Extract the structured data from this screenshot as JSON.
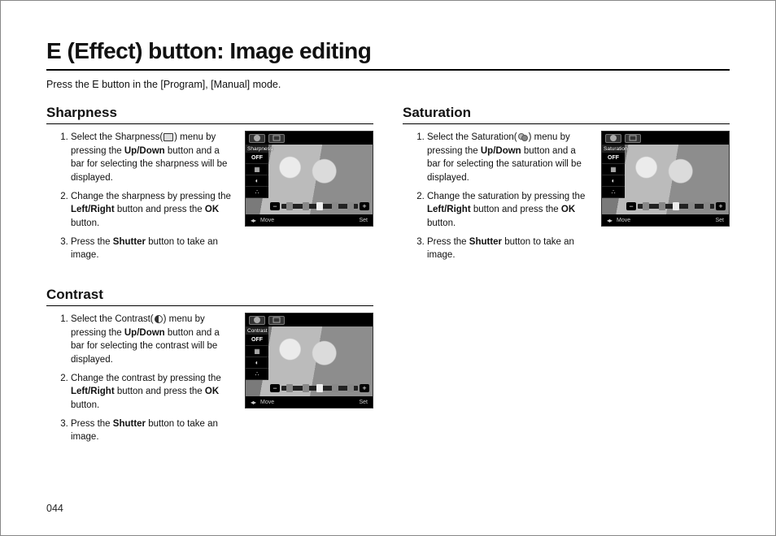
{
  "page_number": "044",
  "title": "E (Effect) button: Image editing",
  "intro": "Press the E button in the [Program], [Manual] mode.",
  "sections": {
    "sharpness": {
      "heading": "Sharpness",
      "step1_a": "Select the Sharpness(",
      "step1_b": ") menu by pressing the ",
      "step1_c": " button and a bar for selecting the sharpness will be displayed.",
      "step2_a": "Change the sharpness by pressing the ",
      "step2_b": " button and press the ",
      "step2_c": " button.",
      "step3_a": "Press the ",
      "step3_b": " button to take an image.",
      "screen_label": "Sharpness"
    },
    "contrast": {
      "heading": "Contrast",
      "step1_a": "Select the Contrast(",
      "step1_b": ") menu by pressing the ",
      "step1_c": " button and a bar for selecting the contrast will be displayed.",
      "step2_a": "Change the contrast by pressing the ",
      "step2_b": " button and press the ",
      "step2_c": " button.",
      "step3_a": "Press the ",
      "step3_b": " button to take an image.",
      "screen_label": "Contrast"
    },
    "saturation": {
      "heading": "Saturation",
      "step1_a": "Select the Saturation(",
      "step1_b": ") menu by pressing the ",
      "step1_c": " button and a bar for selecting the saturation will be displayed.",
      "step2_a": "Change the saturation by pressing the ",
      "step2_b": " button and press the ",
      "step2_c": " button.",
      "step3_a": "Press the ",
      "step3_b": " button to take an image.",
      "screen_label": "Saturation"
    }
  },
  "buttons": {
    "updown": "Up/Down",
    "leftright": "Left/Right",
    "ok": "OK",
    "shutter": "Shutter"
  },
  "screen_ui": {
    "off": "OFF",
    "move": "Move",
    "set": "Set",
    "minus": "−",
    "plus": "+"
  }
}
